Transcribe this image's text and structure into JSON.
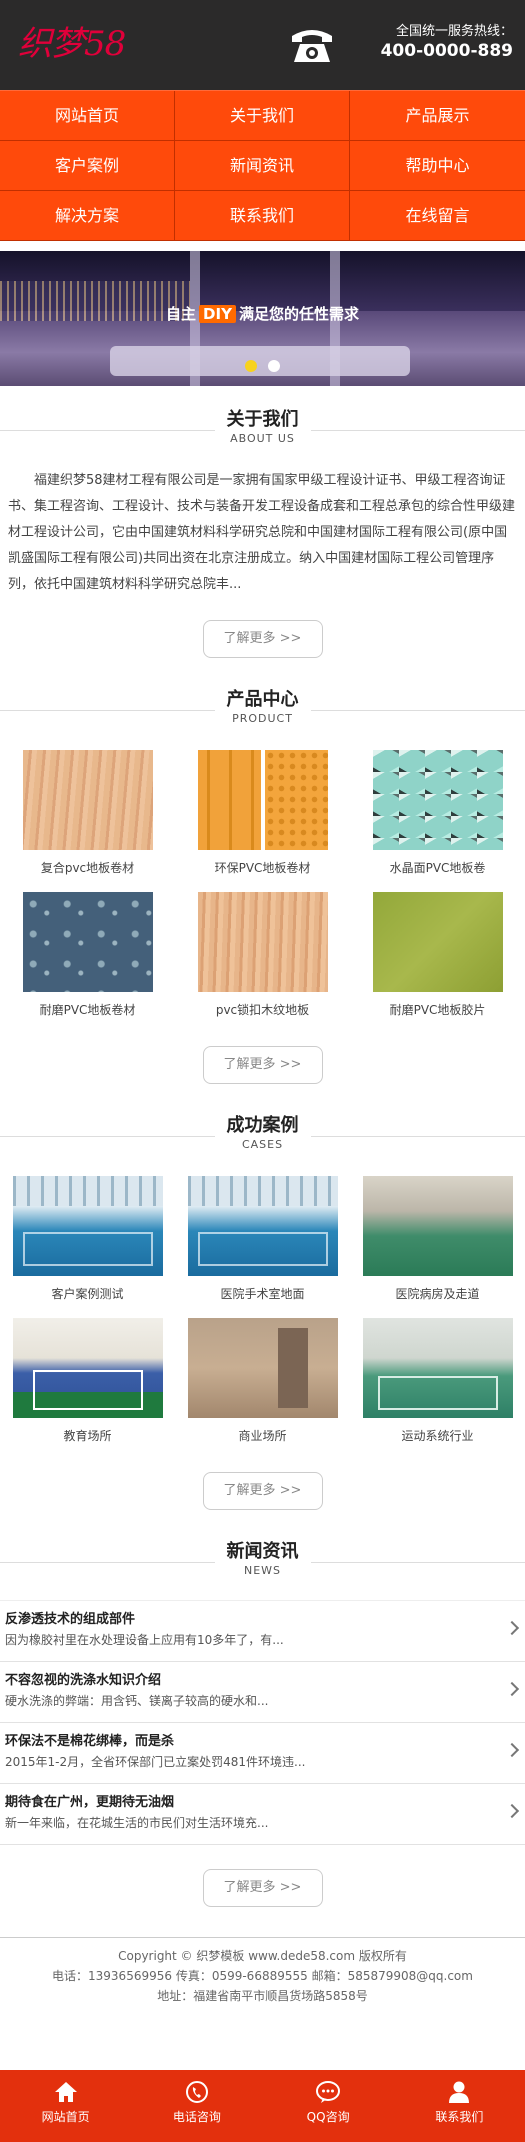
{
  "header": {
    "logo_text": "织梦58",
    "hotline_label": "全国统一服务热线：",
    "hotline_number": "400-0000-889"
  },
  "nav": {
    "items": [
      {
        "label": "网站首页"
      },
      {
        "label": "关于我们"
      },
      {
        "label": "产品展示"
      },
      {
        "label": "客户案例"
      },
      {
        "label": "新闻资讯"
      },
      {
        "label": "帮助中心"
      },
      {
        "label": "解决方案"
      },
      {
        "label": "联系我们"
      },
      {
        "label": "在线留言"
      }
    ]
  },
  "banner": {
    "slogan_before": "自主",
    "slogan_tag": "DIY",
    "slogan_after": "满足您的任性需求",
    "slide_count": 2,
    "active_slide": 1
  },
  "about": {
    "title": "关于我们",
    "subtitle": "ABOUT US",
    "text": "福建织梦58建材工程有限公司是一家拥有国家甲级工程设计证书、甲级工程咨询证书、集工程咨询、工程设计、技术与装备开发工程设备成套和工程总承包的综合性甲级建材工程设计公司，它由中国建筑材料科学研究总院和中国建材国际工程有限公司(原中国凯盛国际工程有限公司)共同出资在北京注册成立。纳入中国建材国际工程公司管理序列，依托中国建筑材料科学研究总院丰...",
    "more": "了解更多 >>"
  },
  "products": {
    "title": "产品中心",
    "subtitle": "PRODUCT",
    "items": [
      {
        "name": "复合pvc地板卷材",
        "swatch": "wood"
      },
      {
        "name": "环保PVC地板卷材",
        "swatch": "yellow"
      },
      {
        "name": "水晶面PVC地板卷",
        "swatch": "crystal"
      },
      {
        "name": "耐磨PVC地板卷材",
        "swatch": "blue"
      },
      {
        "name": "pvc锁扣木纹地板",
        "swatch": "wood2"
      },
      {
        "name": "耐磨PVC地板胶片",
        "swatch": "green"
      }
    ],
    "more": "了解更多 >>"
  },
  "cases": {
    "title": "成功案例",
    "subtitle": "CASES",
    "items": [
      {
        "name": "客户案例测试"
      },
      {
        "name": "医院手术室地面"
      },
      {
        "name": "医院病房及走道"
      },
      {
        "name": "教育场所"
      },
      {
        "name": "商业场所"
      },
      {
        "name": "运动系统行业"
      }
    ],
    "more": "了解更多 >>"
  },
  "news": {
    "title": "新闻资讯",
    "subtitle": "NEWS",
    "items": [
      {
        "title": "反渗透技术的组成部件",
        "desc": "因为橡胶衬里在水处理设备上应用有10多年了，有..."
      },
      {
        "title": "不容忽视的洗涤水知识介绍",
        "desc": "硬水洗涤的弊端：用含钙、镁离子较高的硬水和..."
      },
      {
        "title": "环保法不是棉花绑棒，而是杀",
        "desc": "2015年1-2月，全省环保部门已立案处罚481件环境违..."
      },
      {
        "title": "期待食在广州，更期待无油烟",
        "desc": "新一年来临，在花城生活的市民们对生活环境充..."
      }
    ],
    "more": "了解更多 >>"
  },
  "footer": {
    "line1": "Copyright © 织梦模板 www.dede58.com 版权所有",
    "line2": "电话：13936569956 传真：0599-66889555 邮箱：585879908@qq.com",
    "line3": "地址：福建省南平市顺昌货场路5858号"
  },
  "tabbar": {
    "items": [
      {
        "label": "网站首页",
        "icon": "home-icon"
      },
      {
        "label": "电话咨询",
        "icon": "phone-icon"
      },
      {
        "label": "QQ咨询",
        "icon": "chat-icon"
      },
      {
        "label": "联系我们",
        "icon": "user-icon"
      }
    ]
  },
  "colors": {
    "nav": "#ff4a0b",
    "tabbar": "#e3300d",
    "header": "#2b2a2a",
    "logo": "#e0003a",
    "active_dot": "#f7d21d"
  }
}
